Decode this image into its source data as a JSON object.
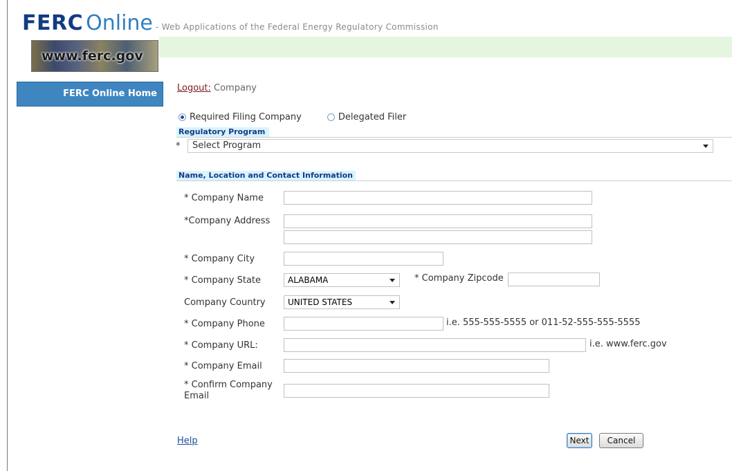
{
  "header": {
    "brand": "FERC",
    "brand_online": "Online",
    "subtitle": "- Web Applications of the Federal Energy Regulatory Commission",
    "logo_text": "www.ferc.gov"
  },
  "sidebar": {
    "home_label": "FERC Online Home"
  },
  "logout": {
    "link_label": "Logout:",
    "user": "Company"
  },
  "filer_type": {
    "options": [
      {
        "label": "Required Filing Company",
        "checked": true
      },
      {
        "label": "Delegated Filer",
        "checked": false
      }
    ]
  },
  "regulatory_program": {
    "heading": "Regulatory Program",
    "required_mark": "*",
    "selected": "Select Program"
  },
  "contact": {
    "heading": "Name, Location and Contact Information",
    "company_name_label": "* Company Name",
    "company_address_label": "*Company Address",
    "company_city_label": "* Company City",
    "company_state_label": "* Company State",
    "company_state_value": "ALABAMA",
    "company_zip_label": "* Company Zipcode",
    "company_country_label": "Company Country",
    "company_country_value": "UNITED STATES",
    "company_phone_label": "* Company Phone",
    "company_phone_hint": "i.e. 555-555-5555 or 011-52-555-555-5555",
    "company_url_label": "* Company URL:",
    "company_url_hint": "i.e. www.ferc.gov",
    "company_email_label": "* Company Email",
    "confirm_email_label_1": "* Confirm Company",
    "confirm_email_label_2": "Email"
  },
  "footer": {
    "help_label": "Help",
    "next_label": "Next",
    "cancel_label": "Cancel"
  },
  "colors": {
    "brand_navy": "#123b84",
    "nav_blue": "#3f86c1",
    "section_bg": "#d9f3ff",
    "header_band": "#e4f6df"
  }
}
